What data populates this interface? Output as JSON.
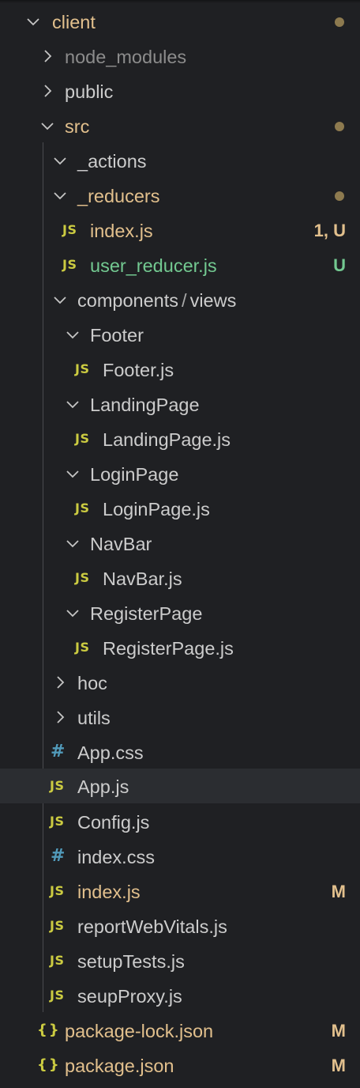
{
  "colors": {
    "background": "#1f2023",
    "selected_row": "#2b2d31",
    "modified": "#e2c08d",
    "untracked": "#73c991",
    "ignored": "#8c8c8c",
    "js_icon": "#cbcb41",
    "css_icon": "#519aba",
    "indicator_dot": "#8d7a4f"
  },
  "tree": {
    "items": [
      {
        "kind": "folder",
        "expanded": true,
        "label": "client",
        "status": "modified",
        "badge": "",
        "dot": true
      },
      {
        "kind": "folder",
        "expanded": false,
        "label": "node_modules",
        "status": "ignored",
        "badge": "",
        "dot": false
      },
      {
        "kind": "folder",
        "expanded": false,
        "label": "public",
        "status": "default",
        "badge": "",
        "dot": false
      },
      {
        "kind": "folder",
        "expanded": true,
        "label": "src",
        "status": "modified",
        "badge": "",
        "dot": true
      },
      {
        "kind": "folder",
        "expanded": true,
        "label": "_actions",
        "status": "default",
        "badge": "",
        "dot": false
      },
      {
        "kind": "folder",
        "expanded": true,
        "label": "_reducers",
        "status": "modified",
        "badge": "",
        "dot": true
      },
      {
        "kind": "file",
        "icon": "JS",
        "icon_name": "js-file-icon",
        "label": "index.js",
        "status": "modified",
        "badge": "1, U",
        "dot": false
      },
      {
        "kind": "file",
        "icon": "JS",
        "icon_name": "js-file-icon",
        "label": "user_reducer.js",
        "status": "untracked",
        "badge": "U",
        "dot": false
      },
      {
        "kind": "folder",
        "expanded": true,
        "label": "components",
        "label2": "views",
        "status": "default",
        "badge": "",
        "dot": false
      },
      {
        "kind": "folder",
        "expanded": true,
        "label": "Footer",
        "status": "default",
        "badge": "",
        "dot": false
      },
      {
        "kind": "file",
        "icon": "JS",
        "icon_name": "js-file-icon",
        "label": "Footer.js",
        "status": "default",
        "badge": "",
        "dot": false
      },
      {
        "kind": "folder",
        "expanded": true,
        "label": "LandingPage",
        "status": "default",
        "badge": "",
        "dot": false
      },
      {
        "kind": "file",
        "icon": "JS",
        "icon_name": "js-file-icon",
        "label": "LandingPage.js",
        "status": "default",
        "badge": "",
        "dot": false
      },
      {
        "kind": "folder",
        "expanded": true,
        "label": "LoginPage",
        "status": "default",
        "badge": "",
        "dot": false
      },
      {
        "kind": "file",
        "icon": "JS",
        "icon_name": "js-file-icon",
        "label": "LoginPage.js",
        "status": "default",
        "badge": "",
        "dot": false
      },
      {
        "kind": "folder",
        "expanded": true,
        "label": "NavBar",
        "status": "default",
        "badge": "",
        "dot": false
      },
      {
        "kind": "file",
        "icon": "JS",
        "icon_name": "js-file-icon",
        "label": "NavBar.js",
        "status": "default",
        "badge": "",
        "dot": false
      },
      {
        "kind": "folder",
        "expanded": true,
        "label": "RegisterPage",
        "status": "default",
        "badge": "",
        "dot": false
      },
      {
        "kind": "file",
        "icon": "JS",
        "icon_name": "js-file-icon",
        "label": "RegisterPage.js",
        "status": "default",
        "badge": "",
        "dot": false
      },
      {
        "kind": "folder",
        "expanded": false,
        "label": "hoc",
        "status": "default",
        "badge": "",
        "dot": false
      },
      {
        "kind": "folder",
        "expanded": false,
        "label": "utils",
        "status": "default",
        "badge": "",
        "dot": false
      },
      {
        "kind": "file",
        "icon": "#",
        "icon_name": "css-file-icon",
        "label": "App.css",
        "status": "default",
        "badge": "",
        "dot": false
      },
      {
        "kind": "file",
        "icon": "JS",
        "icon_name": "js-file-icon",
        "label": "App.js",
        "status": "default",
        "badge": "",
        "dot": false,
        "selected": true
      },
      {
        "kind": "file",
        "icon": "JS",
        "icon_name": "js-file-icon",
        "label": "Config.js",
        "status": "default",
        "badge": "",
        "dot": false
      },
      {
        "kind": "file",
        "icon": "#",
        "icon_name": "css-file-icon",
        "label": "index.css",
        "status": "default",
        "badge": "",
        "dot": false
      },
      {
        "kind": "file",
        "icon": "JS",
        "icon_name": "js-file-icon",
        "label": "index.js",
        "status": "modified",
        "badge": "M",
        "dot": false
      },
      {
        "kind": "file",
        "icon": "JS",
        "icon_name": "js-file-icon",
        "label": "reportWebVitals.js",
        "status": "default",
        "badge": "",
        "dot": false
      },
      {
        "kind": "file",
        "icon": "JS",
        "icon_name": "js-file-icon",
        "label": "setupTests.js",
        "status": "default",
        "badge": "",
        "dot": false
      },
      {
        "kind": "file",
        "icon": "JS",
        "icon_name": "js-file-icon",
        "label": "seupProxy.js",
        "status": "default",
        "badge": "",
        "dot": false
      },
      {
        "kind": "file",
        "icon": "{}",
        "icon_name": "json-file-icon",
        "label": "package-lock.json",
        "status": "modified",
        "badge": "M",
        "dot": false
      },
      {
        "kind": "file",
        "icon": "{}",
        "icon_name": "json-file-icon",
        "label": "package.json",
        "status": "modified",
        "badge": "M",
        "dot": false
      }
    ]
  }
}
